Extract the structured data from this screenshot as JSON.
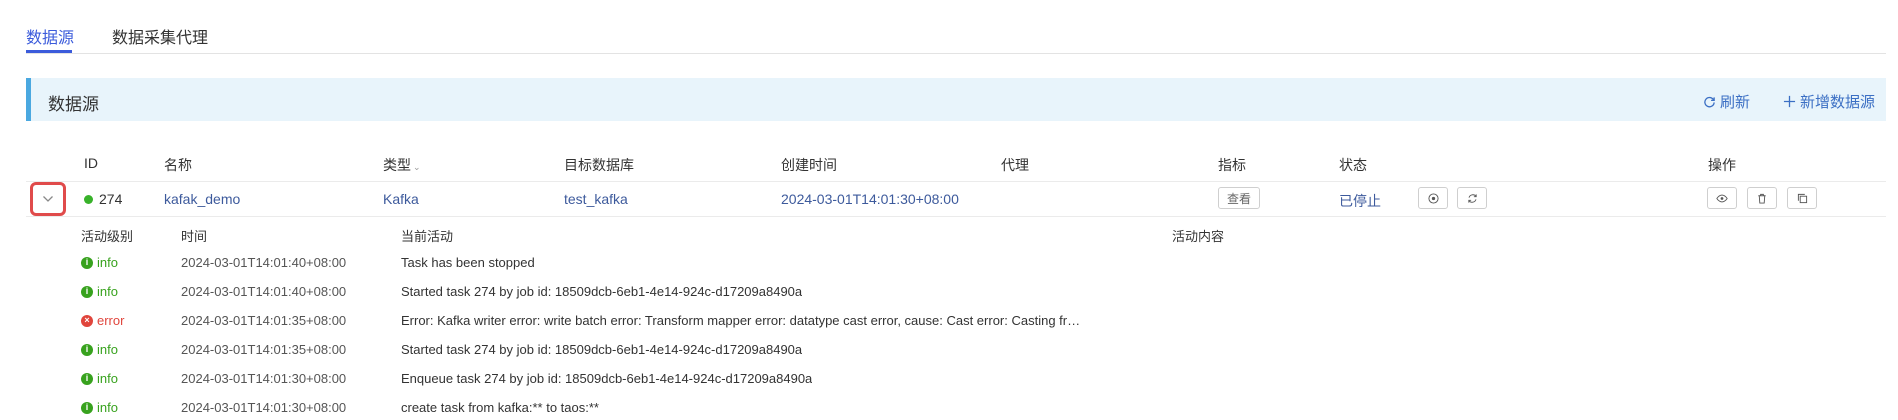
{
  "tabs": [
    {
      "label": "数据源",
      "active": true
    },
    {
      "label": "数据采集代理",
      "active": false
    }
  ],
  "panel": {
    "title": "数据源",
    "refresh_label": "刷新",
    "add_label": "新增数据源"
  },
  "table": {
    "columns": {
      "id": "ID",
      "name": "名称",
      "type": "类型",
      "target_db": "目标数据库",
      "created_time": "创建时间",
      "agent": "代理",
      "metrics": "指标",
      "status": "状态",
      "actions": "操作"
    },
    "row": {
      "id": "274",
      "name": "kafak_demo",
      "type": "Kafka",
      "target_db": "test_kafka",
      "created_time": "2024-03-01T14:01:30+08:00",
      "agent": "",
      "metrics_button": "查看",
      "status": "已停止",
      "status_color": "#38b22a"
    }
  },
  "activity": {
    "columns": {
      "level": "活动级别",
      "time": "时间",
      "current": "当前活动",
      "content": "活动内容"
    },
    "rows": [
      {
        "level": "info",
        "time": "2024-03-01T14:01:40+08:00",
        "activity": "Task has been stopped"
      },
      {
        "level": "info",
        "time": "2024-03-01T14:01:40+08:00",
        "activity": "Started task 274 by job id: 18509dcb-6eb1-4e14-924c-d17209a8490a"
      },
      {
        "level": "error",
        "time": "2024-03-01T14:01:35+08:00",
        "activity": "Error: Kafka writer error: write batch error: Transform mapper error: datatype cast error, cause: Cast error: Casting fr…"
      },
      {
        "level": "info",
        "time": "2024-03-01T14:01:35+08:00",
        "activity": "Started task 274 by job id: 18509dcb-6eb1-4e14-924c-d17209a8490a"
      },
      {
        "level": "info",
        "time": "2024-03-01T14:01:30+08:00",
        "activity": "Enqueue task 274 by job id: 18509dcb-6eb1-4e14-924c-d17209a8490a"
      },
      {
        "level": "info",
        "time": "2024-03-01T14:01:30+08:00",
        "activity": "create task from kafka:** to taos:**"
      }
    ]
  },
  "colors": {
    "accent": "#3b5bdb",
    "info": "#38a21e",
    "error": "#e0453c",
    "header_bg": "#e8f4fb",
    "header_border": "#4aa8e0"
  }
}
